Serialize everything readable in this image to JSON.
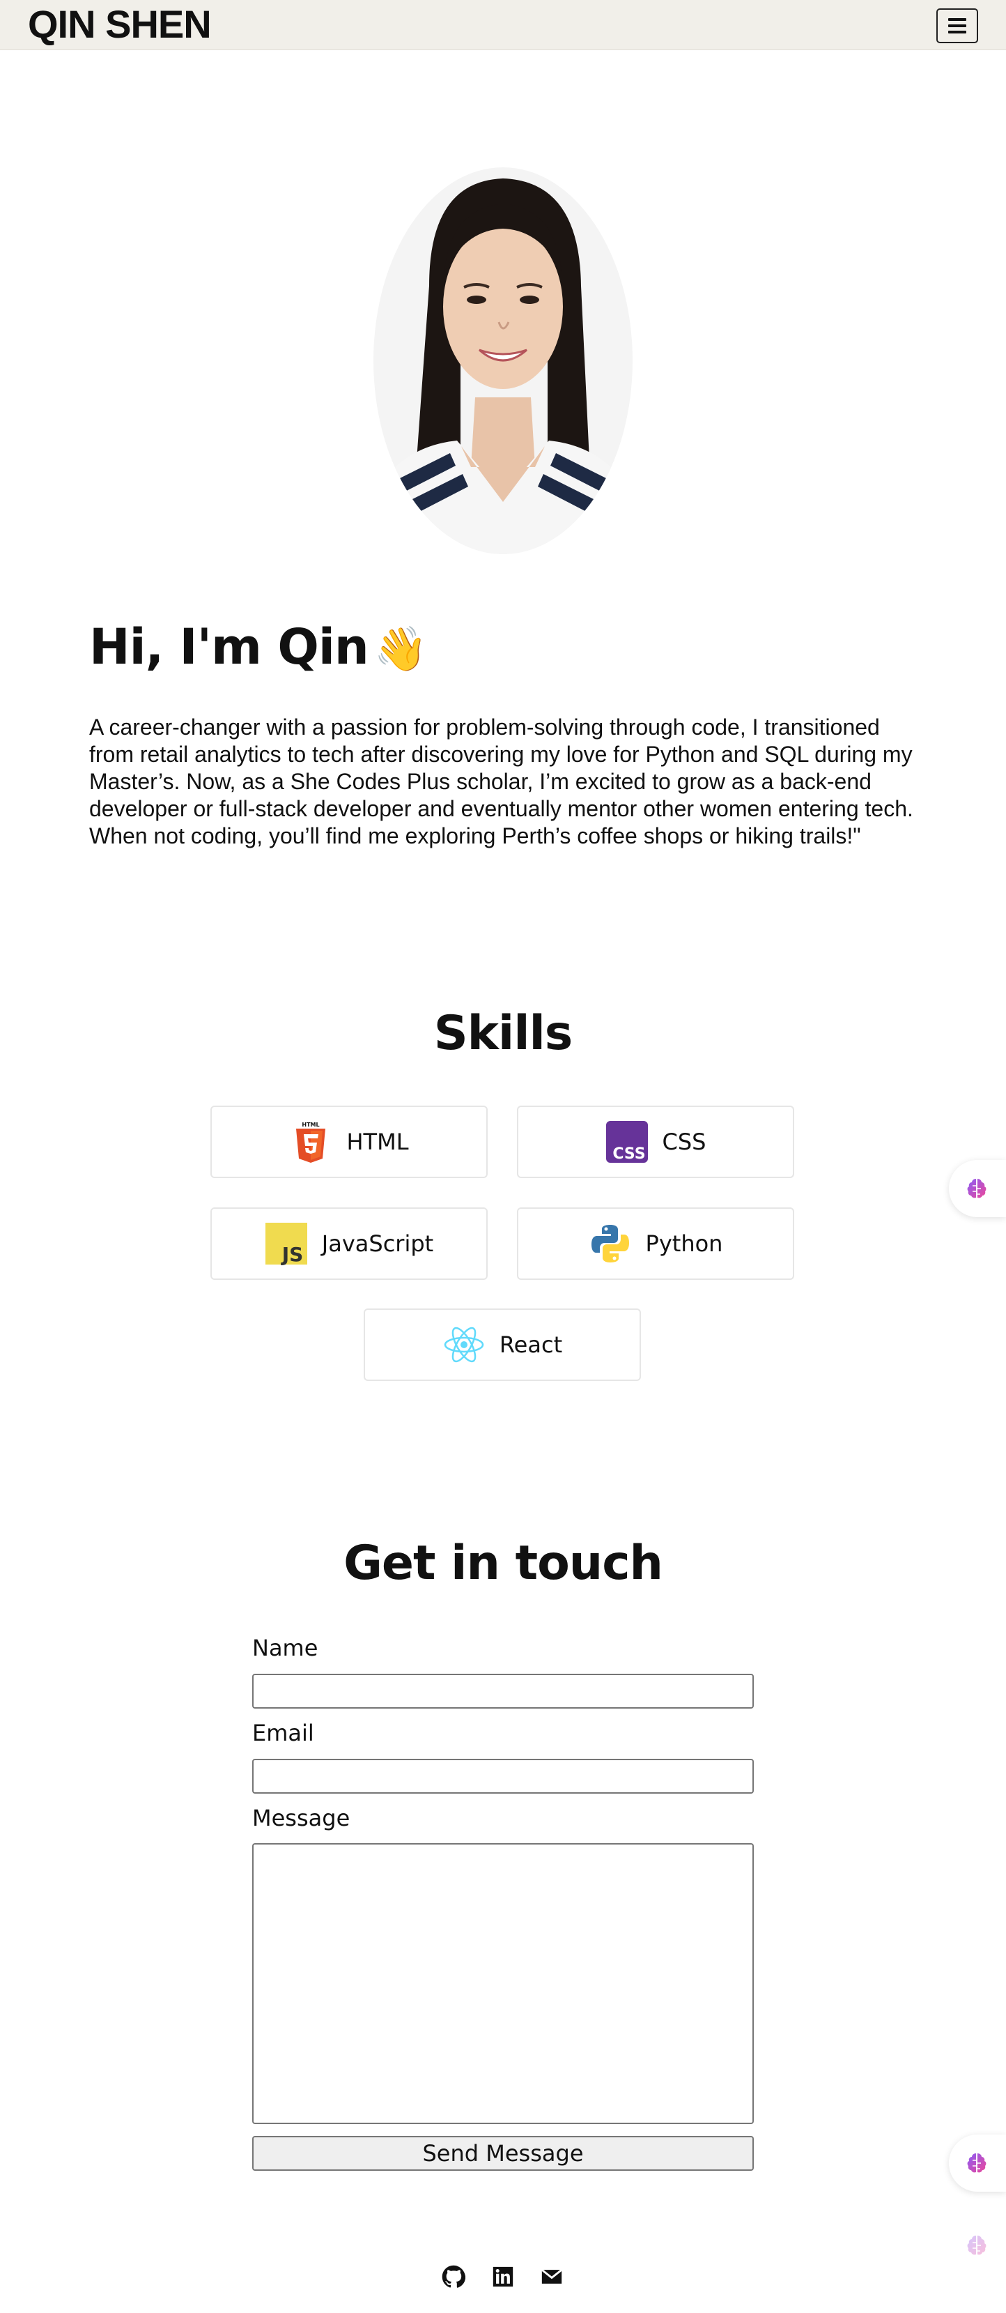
{
  "header": {
    "logo": "QIN SHEN",
    "menu_icon": "hamburger-icon"
  },
  "hero": {
    "avatar_alt": "Qin Shen",
    "title": "Hi, I'm Qin",
    "wave_emoji": "👋",
    "intro": "A career-changer with a passion for problem-solving through code, I transitioned from retail analytics to tech after discovering my love for Python and SQL during my Master’s. Now, as a She Codes Plus scholar, I’m excited to grow as a back-end developer or full-stack developer and eventually mentor other women entering tech. When not coding, you’ll find me exploring Perth’s coffee shops or hiking trails!\""
  },
  "skills": {
    "title": "Skills",
    "items": [
      {
        "label": "HTML",
        "icon": "html5-icon"
      },
      {
        "label": "CSS",
        "icon": "css-icon"
      },
      {
        "label": "JavaScript",
        "icon": "javascript-icon"
      },
      {
        "label": "Python",
        "icon": "python-icon"
      },
      {
        "label": "React",
        "icon": "react-icon"
      }
    ]
  },
  "contact": {
    "title": "Get in touch",
    "name_label": "Name",
    "name_value": "",
    "email_label": "Email",
    "email_value": "",
    "message_label": "Message",
    "message_value": "",
    "submit_label": "Send Message"
  },
  "footer": {
    "links": [
      {
        "icon": "github-icon"
      },
      {
        "icon": "linkedin-icon"
      },
      {
        "icon": "email-icon"
      }
    ]
  },
  "floating_widgets": [
    {
      "icon": "brain-icon"
    },
    {
      "icon": "brain-icon"
    },
    {
      "icon": "brain-icon"
    }
  ],
  "colors": {
    "navbar_bg": "#f1efe9",
    "text": "#111111",
    "html_orange": "#e44d26",
    "css_purple": "#663399",
    "js_yellow": "#f0db4f",
    "python_blue": "#3776ab",
    "python_yellow": "#ffd43b",
    "react_cyan": "#61dafb"
  }
}
